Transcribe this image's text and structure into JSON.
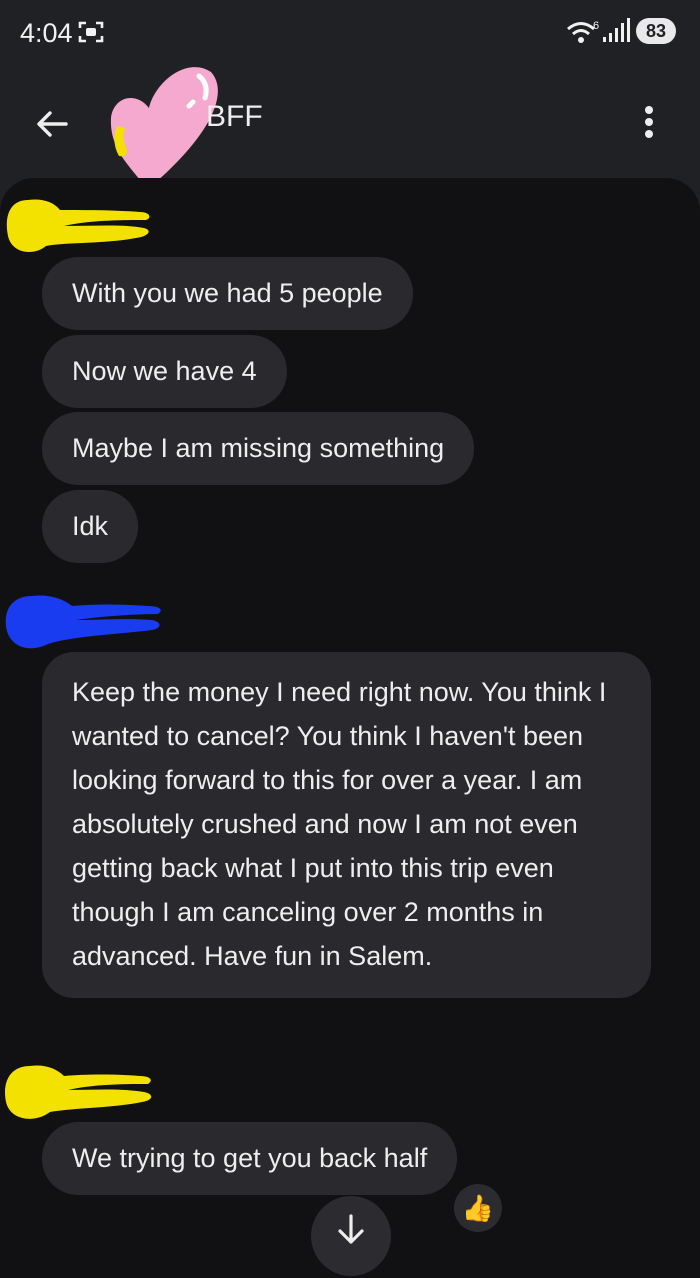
{
  "status_bar": {
    "time": "4:04",
    "battery": "83",
    "wifi_badge": "6"
  },
  "header": {
    "contact_name": "BFF",
    "icons": [
      "arrow-back-icon",
      "more-vert-icon"
    ]
  },
  "messages": [
    {
      "sender": "contact",
      "text": "With you we had 5 people"
    },
    {
      "sender": "contact",
      "text": "Now we have 4"
    },
    {
      "sender": "contact",
      "text": "Maybe I am missing something"
    },
    {
      "sender": "contact",
      "text": "Idk"
    },
    {
      "sender": "other-member",
      "text": "Keep the money I need right now. You think I wanted to cancel? You think I haven't been looking forward to this for over a year. I am absolutely crushed and now I am not even getting back what I put into this trip even though I am canceling over 2 months in advanced. Have fun in Salem."
    },
    {
      "sender": "contact",
      "text": "We trying to get you back half"
    }
  ],
  "reaction": "👍",
  "colors": {
    "background": "#202125",
    "chat_panel": "#111113",
    "bubble": "#2a2a2e",
    "scribble_yellow": "#f3e100",
    "scribble_blue": "#1a3cf0",
    "heart_pink": "#f6a9cf",
    "reaction_yellow": "#ffc83d"
  }
}
